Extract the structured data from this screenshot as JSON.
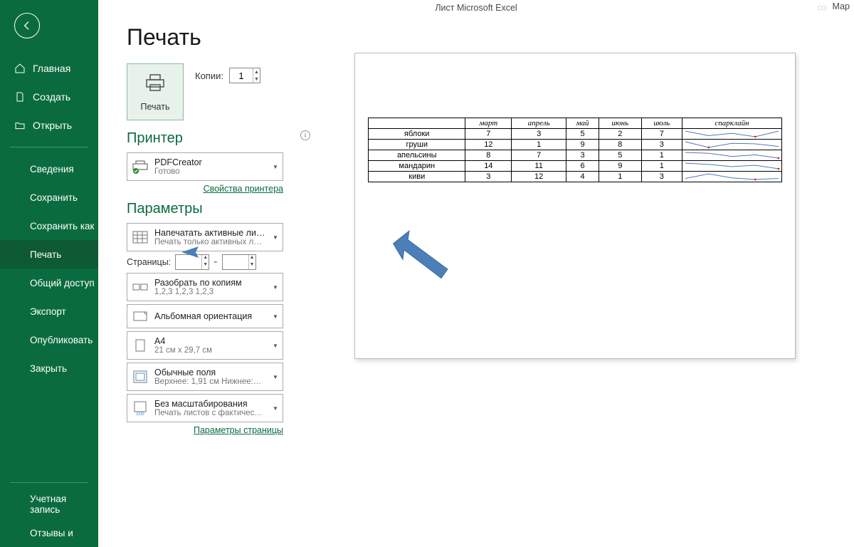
{
  "header": {
    "title": "Лист Microsoft Excel",
    "right": "Мар"
  },
  "sidebar": {
    "main": [
      {
        "icon": "home",
        "label": "Главная"
      },
      {
        "icon": "new",
        "label": "Создать"
      },
      {
        "icon": "open",
        "label": "Открыть"
      }
    ],
    "secondary": [
      "Сведения",
      "Сохранить",
      "Сохранить как",
      "Печать",
      "Общий доступ",
      "Экспорт",
      "Опубликовать",
      "Закрыть"
    ],
    "selected": "Печать",
    "footer": [
      "Учетная запись",
      "Отзывы и"
    ]
  },
  "page": {
    "title": "Печать"
  },
  "print_button": {
    "label": "Печать"
  },
  "copies": {
    "label": "Копии:",
    "value": "1"
  },
  "printer": {
    "section": "Принтер",
    "name": "PDFCreator",
    "status": "Готово",
    "link": "Свойства принтера"
  },
  "settings": {
    "section": "Параметры",
    "print_what": {
      "l1": "Напечатать активные листы",
      "l2": "Печать только активных л…"
    },
    "pages": {
      "label": "Страницы:",
      "from": "",
      "to": "",
      "dash": "-"
    },
    "collate": {
      "l1": "Разобрать по копиям",
      "l2": "1,2,3    1,2,3    1,2,3"
    },
    "orientation": {
      "l1": "Альбомная ориентация"
    },
    "paper": {
      "l1": "A4",
      "l2": "21 см x 29,7 см"
    },
    "margins": {
      "l1": "Обычные поля",
      "l2": "Верхнее: 1,91 см Нижнее:…"
    },
    "scale": {
      "l1": "Без масштабирования",
      "l2": "Печать листов с фактичес…"
    },
    "page_setup": "Параметры страницы"
  },
  "chart_data": {
    "type": "table",
    "headers": [
      "",
      "март",
      "апрель",
      "май",
      "июнь",
      "июль",
      "спарклайн"
    ],
    "rows": [
      {
        "label": "яблоки",
        "v": [
          7,
          3,
          5,
          2,
          7
        ]
      },
      {
        "label": "груши",
        "v": [
          12,
          1,
          9,
          8,
          3
        ]
      },
      {
        "label": "апельсины",
        "v": [
          8,
          7,
          3,
          5,
          1
        ]
      },
      {
        "label": "мандарин",
        "v": [
          14,
          11,
          6,
          9,
          1
        ]
      },
      {
        "label": "киви",
        "v": [
          3,
          12,
          4,
          1,
          3
        ]
      }
    ]
  }
}
